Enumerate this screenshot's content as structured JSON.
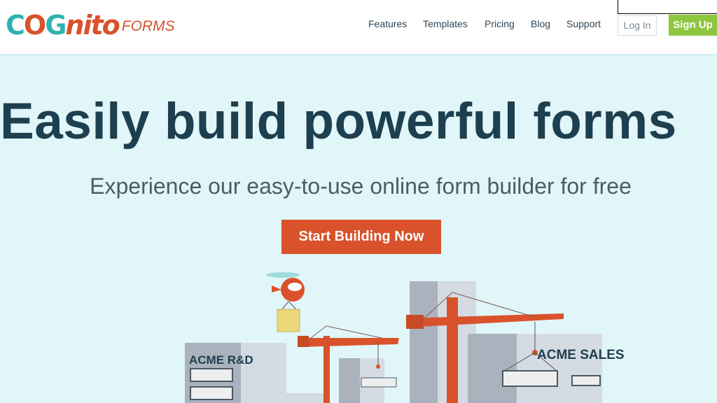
{
  "header": {
    "logo_text": "COGNITO FORMS",
    "nav": [
      "Features",
      "Templates",
      "Pricing",
      "Blog",
      "Support"
    ],
    "login_label": "Log In",
    "signup_label": "Sign Up"
  },
  "hero": {
    "title": "Easily build powerful forms",
    "subtitle": "Experience our easy-to-use online form builder for free",
    "cta_label": "Start Building Now"
  },
  "illustration": {
    "building_left": "ACME R&D",
    "building_right": "ACME SALES"
  },
  "colors": {
    "brand_orange": "#d9522b",
    "brand_teal": "#2fb3ad",
    "signup_green": "#8dc63f",
    "title": "#1e3f4f",
    "background": "#e1f6f8"
  }
}
